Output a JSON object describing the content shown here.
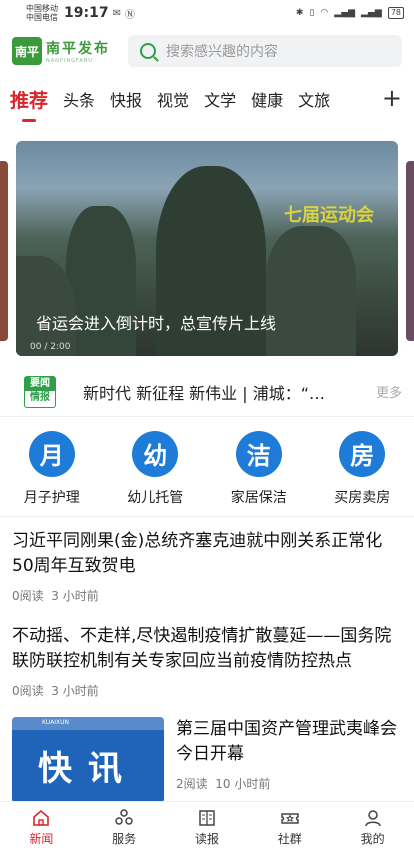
{
  "status": {
    "carrier1": "中国移动",
    "carrier2": "中国电信",
    "time": "19:17",
    "battery": "78"
  },
  "header": {
    "logo_text": "南平发布",
    "logo_mark": "南平",
    "logo_en": "NANPINGFABU",
    "search_placeholder": "搜索感兴趣的内容"
  },
  "tabs": [
    "推荐",
    "头条",
    "快报",
    "视觉",
    "文学",
    "健康",
    "文旅"
  ],
  "tabs_more_icon": "plus-icon",
  "banner": {
    "caption": "省运会进入倒计时，总宣传片上线",
    "video_time": "00 / 2:00",
    "overlay_text": "七届运动会"
  },
  "ticker": {
    "badge_top": "要闻",
    "badge_bottom": "情报",
    "text": "新时代 新征程 新伟业 | 浦城：“…",
    "more": "更多"
  },
  "services": [
    {
      "glyph": "月",
      "label": "月子护理"
    },
    {
      "glyph": "幼",
      "label": "幼儿托管"
    },
    {
      "glyph": "洁",
      "label": "家居保洁"
    },
    {
      "glyph": "房",
      "label": "买房卖房"
    }
  ],
  "articles": [
    {
      "title": "习近平同刚果(金)总统齐塞克迪就中刚关系正常化50周年互致贺电",
      "reads": "0阅读",
      "time": "3 小时前"
    },
    {
      "title": "不动摇、不走样,尽快遏制疫情扩散蔓延——国务院联防联控机制有关专家回应当前疫情防控热点",
      "reads": "0阅读",
      "time": "3 小时前"
    }
  ],
  "image_article": {
    "thumb_text": "快讯",
    "thumb_tag": "KUAIXUN",
    "title": "第三届中国资产管理武夷峰会今日开幕",
    "reads": "2阅读",
    "time": "10 小时前"
  },
  "bottom_nav": [
    {
      "label": "新闻",
      "icon": "home-icon",
      "active": true
    },
    {
      "label": "服务",
      "icon": "services-icon"
    },
    {
      "label": "读报",
      "icon": "newspaper-icon"
    },
    {
      "label": "社群",
      "icon": "ticket-icon"
    },
    {
      "label": "我的",
      "icon": "profile-icon"
    }
  ],
  "colors": {
    "accent": "#d7262c",
    "brand_green": "#3a9b3a",
    "service_blue": "#1e7bd8"
  }
}
